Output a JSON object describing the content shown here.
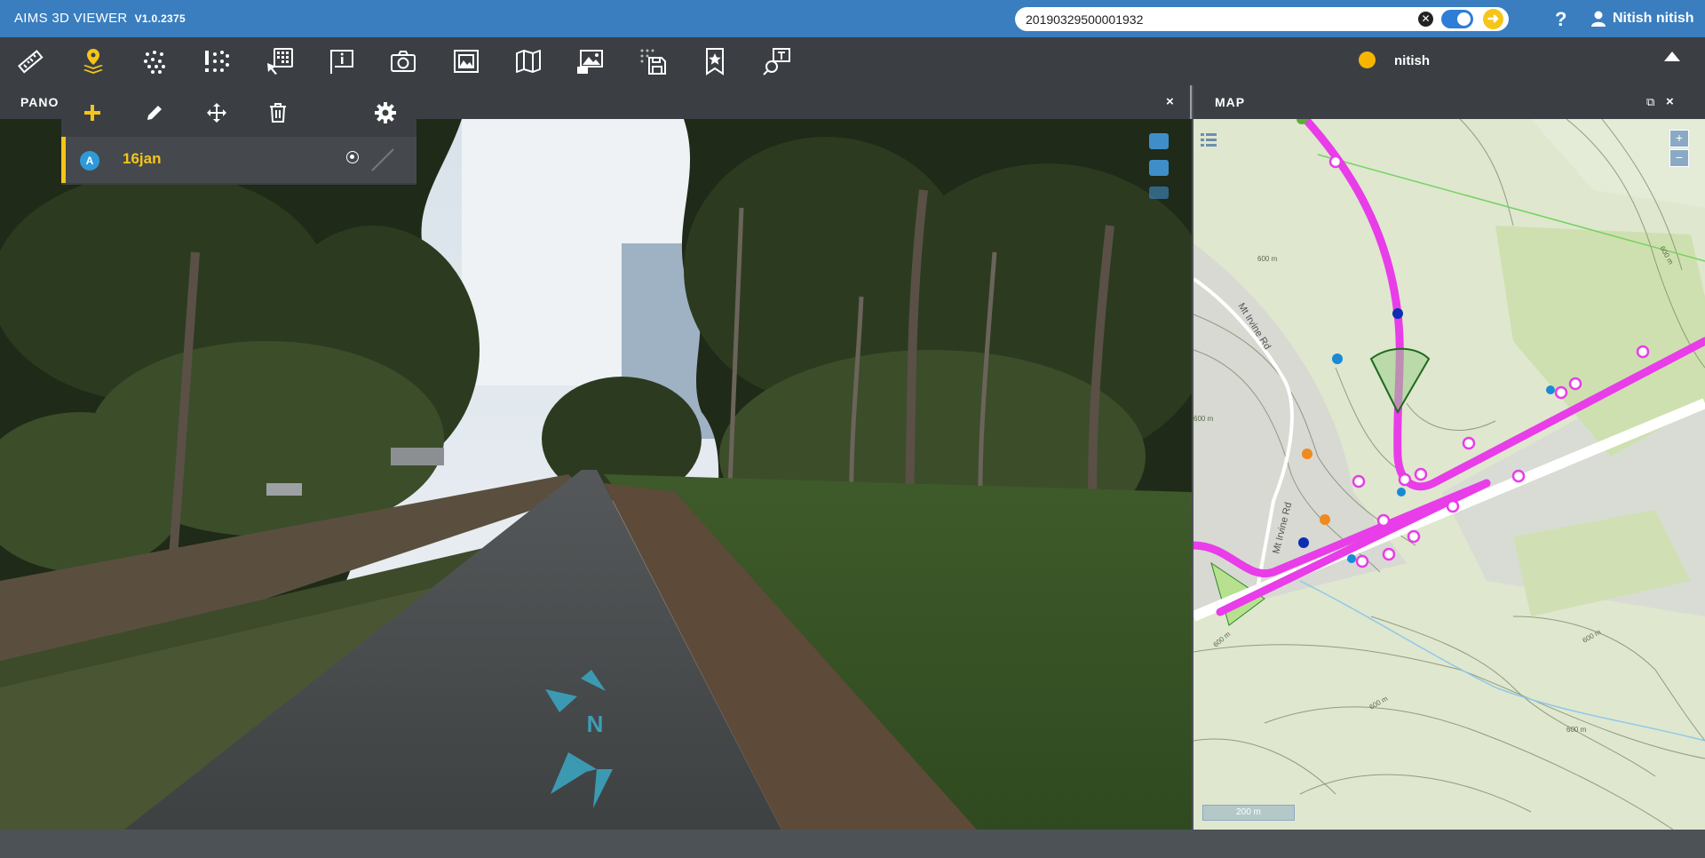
{
  "app": {
    "title": "AIMS 3D VIEWER",
    "version": "V1.0.2375"
  },
  "search": {
    "value": "20190329500001932",
    "clear_icon": "close-circle-icon",
    "toggle_on": true,
    "go_icon": "arrow-right-circle-icon"
  },
  "header": {
    "help_label": "?",
    "user_name": "Nitish nitish",
    "user_icon": "user-icon"
  },
  "toolbar": {
    "tools": [
      "ruler-icon",
      "marker-layers-icon",
      "dot-grid-icon",
      "alert-grid-icon",
      "keypad-pointer-icon",
      "info-flag-icon",
      "camera-icon",
      "frame-image-icon",
      "map-icon",
      "image-pin-icon",
      "save-grid-icon",
      "bookmark-star-icon",
      "search-sign-icon"
    ],
    "status_user": "nitish",
    "status_color": "#f7b500"
  },
  "pano": {
    "title": "PANO",
    "close_label": "×",
    "compass_label": "N"
  },
  "layer_panel": {
    "tools": [
      "plus-icon",
      "pencil-icon",
      "move-icon",
      "trash-icon",
      "gear-icon"
    ],
    "layer": {
      "badge": "A",
      "name": "16jan"
    }
  },
  "map": {
    "title": "MAP",
    "close_label": "×",
    "zoom_in": "+",
    "zoom_out": "−",
    "scale_label": "200 m",
    "road_labels": [
      "Mt Irvine Rd",
      "Mt Irvine Rd"
    ],
    "contour_labels": [
      "600 m",
      "600 m",
      "600 m",
      "600 m",
      "600 m",
      "600 m",
      "600 m"
    ],
    "route_color": "#e83de8"
  },
  "colors": {
    "header": "#3a7ebf",
    "toolbar": "#3b3f44",
    "accent": "#f5c518"
  }
}
